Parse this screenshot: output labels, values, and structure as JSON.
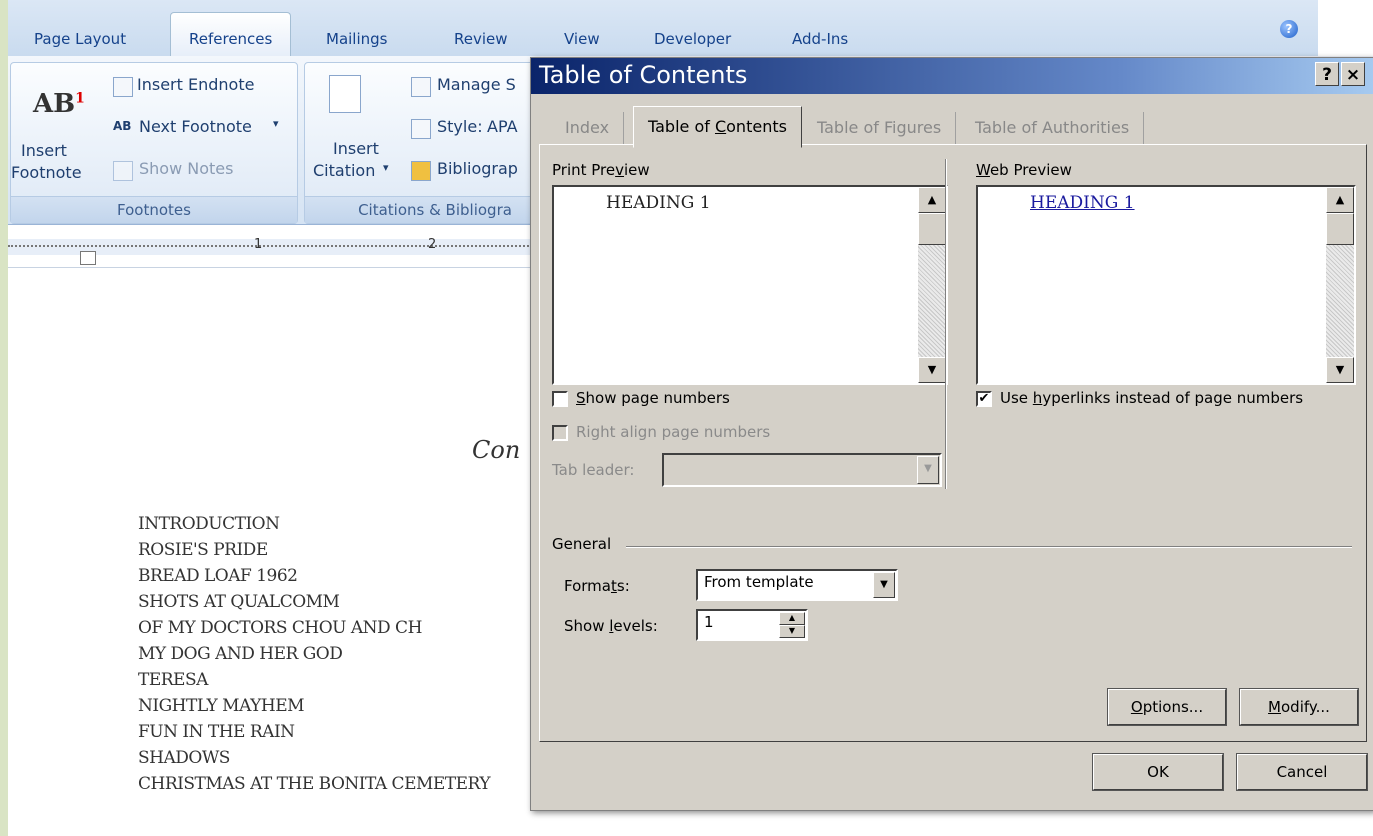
{
  "ribbon": {
    "tabs": [
      "Page Layout",
      "References",
      "Mailings",
      "Review",
      "View",
      "Developer",
      "Add-Ins"
    ],
    "active_tab": "References",
    "footnotes": {
      "insert_endnote": "Insert Endnote",
      "next_footnote": "Next Footnote",
      "insert_footnote_1": "Insert",
      "insert_footnote_2": "Footnote",
      "show_notes": "Show Notes",
      "group_label": "Footnotes"
    },
    "citations": {
      "manage_sources": "Manage S",
      "style_label": "Style:",
      "style_value": "APA",
      "bibliography": "Bibliograp",
      "insert_citation_1": "Insert",
      "insert_citation_2": "Citation",
      "group_label": "Citations & Bibliogra"
    }
  },
  "ruler": {
    "marks": [
      "1",
      "2"
    ]
  },
  "document": {
    "heading_fragment": "Con",
    "toc_lines": [
      "INTRODUCTION",
      "ROSIE'S PRIDE",
      "BREAD LOAF 1962",
      "SHOTS AT QUALCOMM",
      "OF MY DOCTORS CHOU AND CH",
      "MY DOG AND HER GOD",
      "TERESA",
      "NIGHTLY MAYHEM",
      "FUN IN THE RAIN",
      "SHADOWS",
      "CHRISTMAS AT THE BONITA CEMETERY"
    ]
  },
  "dialog": {
    "title": "Table of Contents",
    "help": "?",
    "close": "×",
    "tabs": [
      "Index",
      "Table of Contents",
      "Table of Figures",
      "Table of Authorities"
    ],
    "active_tab": "Table of Contents",
    "print_preview_label": "Print Preview",
    "print_preview_text": "HEADING 1",
    "web_preview_label": "Web Preview",
    "web_preview_text": "HEADING 1",
    "show_page_numbers": {
      "label": "Show page numbers",
      "checked": false
    },
    "right_align": {
      "label": "Right align page numbers",
      "checked": false,
      "disabled": true
    },
    "tab_leader": {
      "label": "Tab leader:",
      "value": ""
    },
    "use_hyperlinks": {
      "label": "Use hyperlinks instead of page numbers",
      "checked": true
    },
    "general_label": "General",
    "formats": {
      "label": "Formats:",
      "value": "From template"
    },
    "show_levels": {
      "label": "Show levels:",
      "value": "1"
    },
    "options_button": "Options...",
    "modify_button": "Modify...",
    "ok_button": "OK",
    "cancel_button": "Cancel"
  }
}
